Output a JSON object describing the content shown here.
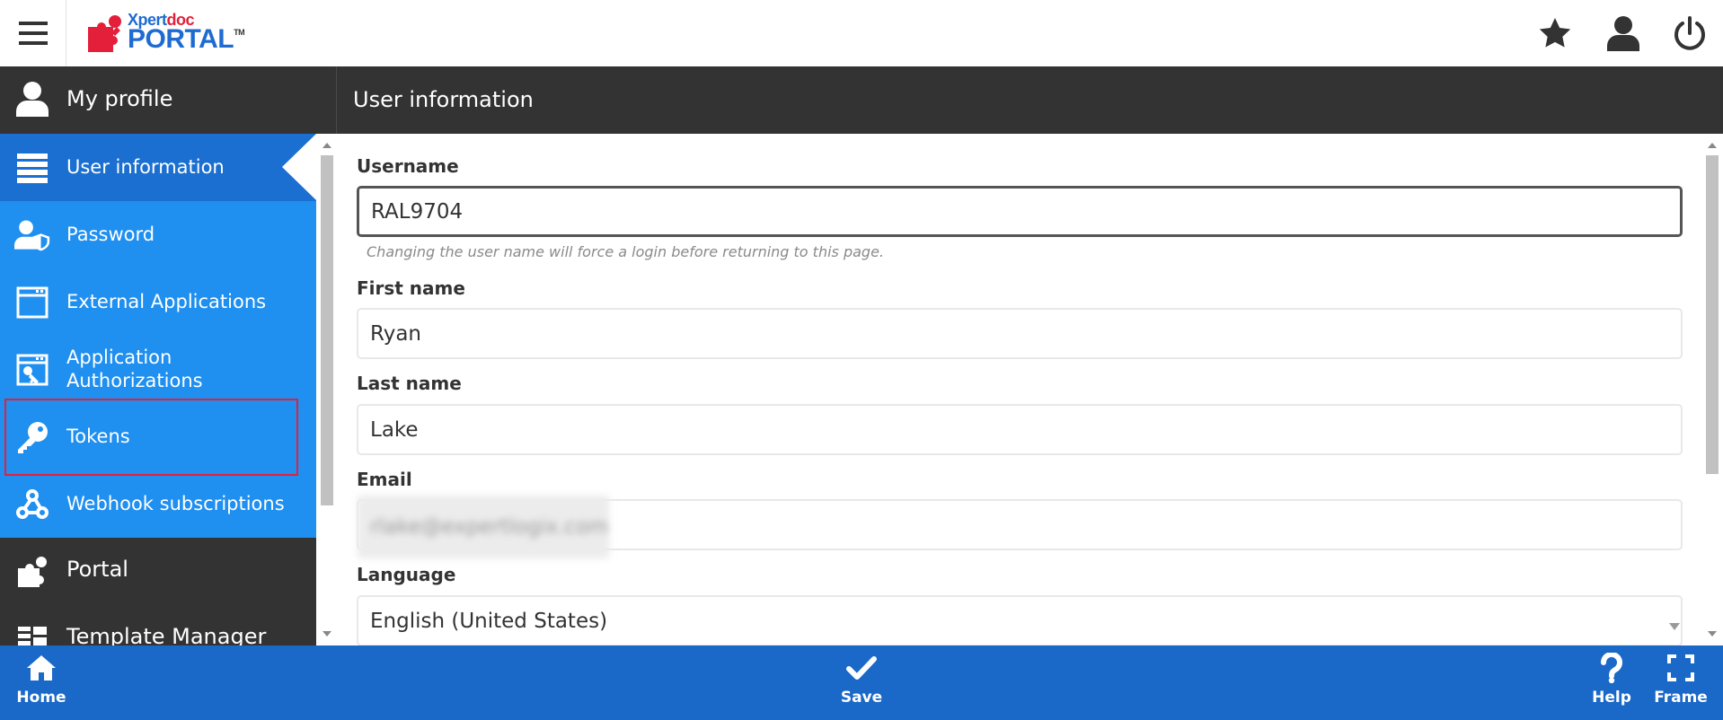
{
  "header": {
    "brand_top_1": "Xpert",
    "brand_top_2": "doc",
    "brand_main": "PORTAL",
    "brand_tm": "TM",
    "icons": [
      "menu-icon",
      "star-icon",
      "user-icon",
      "power-icon"
    ]
  },
  "band": {
    "section_label": "My profile",
    "page_title": "User information"
  },
  "sidebar": {
    "items": [
      {
        "label": "User information",
        "icon": "list-icon",
        "active": true
      },
      {
        "label": "Password",
        "icon": "user-shield-icon"
      },
      {
        "label": "External Applications",
        "icon": "window-icon",
        "highlighted": true
      },
      {
        "label_line1": "Application",
        "label_line2": "Authorizations",
        "icon": "window-key-icon"
      },
      {
        "label": "Tokens",
        "icon": "key-icon"
      },
      {
        "label": "Webhook subscriptions",
        "icon": "webhook-icon"
      },
      {
        "label": "Portal",
        "icon": "puzzle-icon"
      },
      {
        "label": "Template Manager",
        "icon": "template-icon"
      }
    ],
    "highlight_color": "#e41f3a"
  },
  "form": {
    "username": {
      "label": "Username",
      "value": "RAL9704",
      "hint": "Changing the user name will force a login before returning to this page."
    },
    "first_name": {
      "label": "First name",
      "value": "Ryan"
    },
    "last_name": {
      "label": "Last name",
      "value": "Lake"
    },
    "email": {
      "label": "Email",
      "value": "rlake@expertlogix.com"
    },
    "language": {
      "label": "Language",
      "value": "English (United States)"
    }
  },
  "bottombar": {
    "home": "Home",
    "save": "Save",
    "help": "Help",
    "frame": "Frame"
  },
  "colors": {
    "top_band": "#333333",
    "sidebar": "#1f8ff0",
    "sidebar_active": "#1a6fd0",
    "bottombar": "#1a68c8",
    "brand_red": "#e41f3a",
    "brand_blue": "#1e6bd1"
  }
}
